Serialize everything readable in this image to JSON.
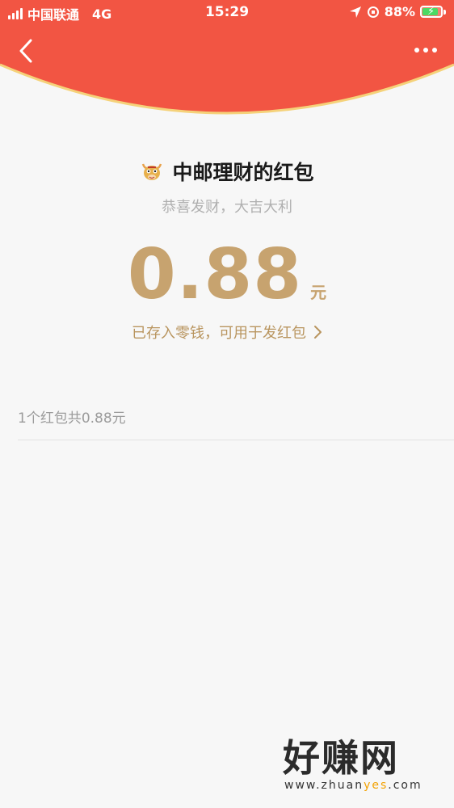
{
  "status_bar": {
    "carrier": "中国联通",
    "network": "4G",
    "time": "15:29",
    "battery": "88%"
  },
  "nav": {
    "back_icon": "chevron-left-icon",
    "more_icon": "more-dots-icon"
  },
  "red_packet": {
    "sender_title": "中邮理财的红包",
    "avatar_icon": "ox-mascot-icon",
    "blessing": "恭喜发财，大吉大利",
    "amount": "0.88",
    "unit": "元",
    "stored_note": "已存入零钱，可用于发红包",
    "summary": "1个红包共0.88元"
  },
  "watermark": {
    "title": "好赚网",
    "url_prefix": "www.zhuan",
    "url_accent": "yes",
    "url_suffix": ".com"
  },
  "colors": {
    "header_red": "#f25543",
    "amount_gold": "#c7a36f",
    "background": "#f7f7f7"
  }
}
